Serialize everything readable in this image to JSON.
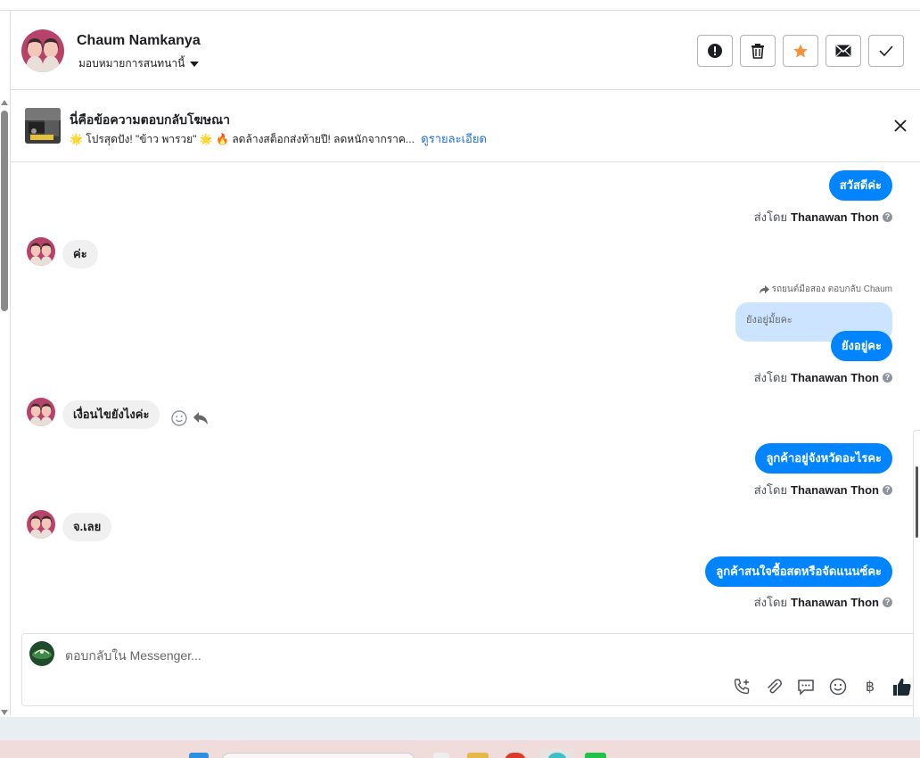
{
  "header": {
    "contact_name": "Chaum Namkanya",
    "assign_label": "มอบหมายการสนทนานี้"
  },
  "actions": [
    "spam-icon",
    "trash-icon",
    "star-icon",
    "mail-icon",
    "check-icon"
  ],
  "colors": {
    "accent": "#0084ff",
    "star": "#f7923a",
    "quoted_bg": "#cce4ff"
  },
  "ad": {
    "title": "นี่คือข้อความตอบกลับโฆษณา",
    "description": "🌟 โปรสุดปัง! \"ข้าว พารวย\" 🌟 🔥 ลดล้างสต็อกส่งท้ายปี! ลดหนักจากราค...",
    "link": "ดูรายละเอียด"
  },
  "messages": {
    "m1": {
      "text": "สวัสดีค่ะ"
    },
    "m1_sent": {
      "prefix": "ส่งโดย",
      "sender": "Thanawan Thon"
    },
    "m2": {
      "text": "ค่ะ"
    },
    "reply_note": "รถยนต์มือสอง ตอบกลับ Chaum",
    "quoted_text": "ยังอยู่มั้ยคะ",
    "m3": {
      "text": "ยังอยู่คะ"
    },
    "m3_sent": {
      "prefix": "ส่งโดย",
      "sender": "Thanawan Thon"
    },
    "m4": {
      "text": "เงื่อนไขยังไงค่ะ"
    },
    "m5": {
      "text": "ลูกค้าอยู่จังหวัดอะไรคะ"
    },
    "m5_sent": {
      "prefix": "ส่งโดย",
      "sender": "Thanawan Thon"
    },
    "m6": {
      "text": "จ.เลย"
    },
    "m7": {
      "text": "ลูกค้าสนใจซื้อสดหรือจัดแนนซ์คะ"
    },
    "m7_sent": {
      "prefix": "ส่งโดย",
      "sender": "Thanawan Thon"
    }
  },
  "composer": {
    "placeholder": "ตอบกลับใน Messenger...",
    "tools": [
      "call-add-icon",
      "attach-icon",
      "saved-reply-icon",
      "emoji-icon",
      "baht-icon",
      "like-icon"
    ],
    "baht_symbol": "฿"
  }
}
